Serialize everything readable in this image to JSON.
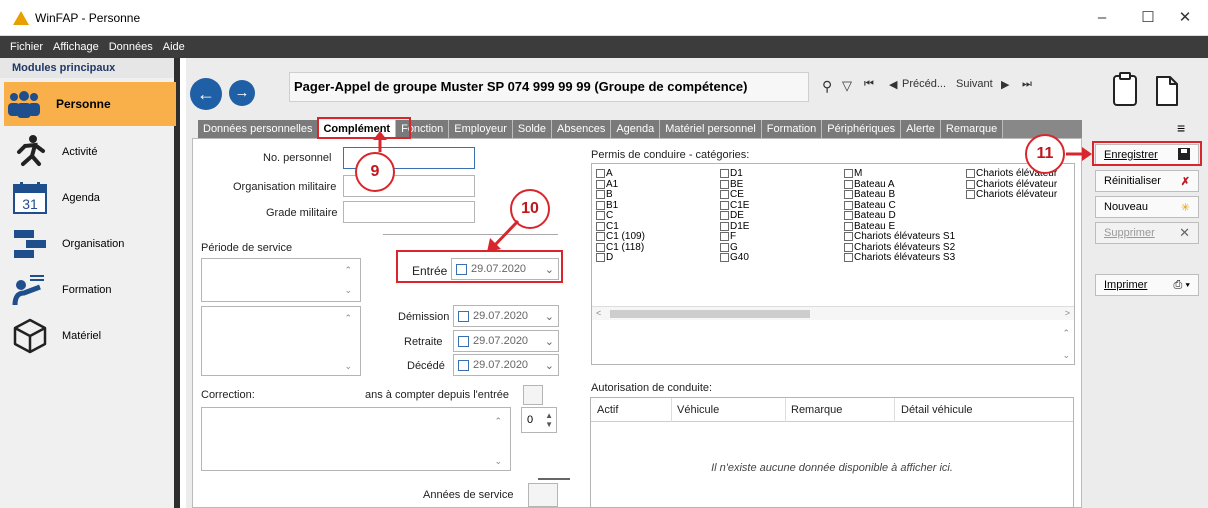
{
  "window": {
    "title": "WinFAP - Personne",
    "controls": [
      "–",
      "☐",
      "✕"
    ]
  },
  "menu": [
    "Fichier",
    "Affichage",
    "Données",
    "Aide"
  ],
  "modules": {
    "header": "Modules principaux",
    "items": [
      {
        "label": "Personne",
        "icon": "people-icon",
        "active": true
      },
      {
        "label": "Activité",
        "icon": "running-man-icon"
      },
      {
        "label": "Agenda",
        "icon": "calendar-icon",
        "calendar_day": "31"
      },
      {
        "label": "Organisation",
        "icon": "organisation-icon"
      },
      {
        "label": "Formation",
        "icon": "teacher-board-icon"
      },
      {
        "label": "Matériel",
        "icon": "cube-icon"
      }
    ]
  },
  "record": {
    "title": "Pager-Appel de groupe Muster SP 074 999 99 99 (Groupe de compétence)",
    "prev_label": "Précéd...",
    "next_label": "Suivant"
  },
  "tabs": [
    "Données personnelles",
    "Complément",
    "Fonction",
    "Employeur",
    "Solde",
    "Absences",
    "Agenda",
    "Matériel personnel",
    "Formation",
    "Périphériques",
    "Alerte",
    "Remarque"
  ],
  "active_tab": "Complément",
  "form": {
    "no_personnel": "No. personnel",
    "org_militaire": "Organisation militaire",
    "grade_militaire": "Grade militaire",
    "periode_service": "Période de service",
    "entree": "Entrée",
    "demission": "Démission",
    "retraite": "Retraite",
    "decede": "Décédé",
    "date_value": "29.07.2020",
    "correction": "Correction:",
    "ans_label": "ans à compter depuis l'entrée",
    "stepper_value": "0",
    "annees_service": "Années de service"
  },
  "permits": {
    "header": "Permis de conduire - catégories:",
    "col1": [
      "A",
      "A1",
      "B",
      "B1",
      "C",
      "C1",
      "C1 (109)",
      "C1 (118)",
      "D"
    ],
    "col2": [
      "D1",
      "BE",
      "CE",
      "C1E",
      "DE",
      "D1E",
      "F",
      "G",
      "G40"
    ],
    "col3": [
      "M",
      "Bateau A",
      "Bateau B",
      "Bateau C",
      "Bateau D",
      "Bateau E",
      "Chariots élévateurs S1",
      "Chariots élévateurs S2",
      "Chariots élévateurs S3"
    ],
    "col4": [
      "Chariots élévateur",
      "Chariots élévateur",
      "Chariots élévateur"
    ]
  },
  "authorisation": {
    "header": "Autorisation de conduite:",
    "columns": [
      "Actif",
      "Véhicule",
      "Remarque",
      "Détail véhicule"
    ],
    "empty": "Il n'existe aucune donnée disponible à afficher ici."
  },
  "actions": {
    "save": "Enregistrer",
    "reset": "Réinitialiser",
    "new": "Nouveau",
    "delete": "Supprimer",
    "print": "Imprimer"
  },
  "callouts": [
    "9",
    "10",
    "11"
  ],
  "colors": {
    "accent_orange": "#f9b04b",
    "callout_red": "#d9262c",
    "nav_blue": "#1f5fa6"
  }
}
